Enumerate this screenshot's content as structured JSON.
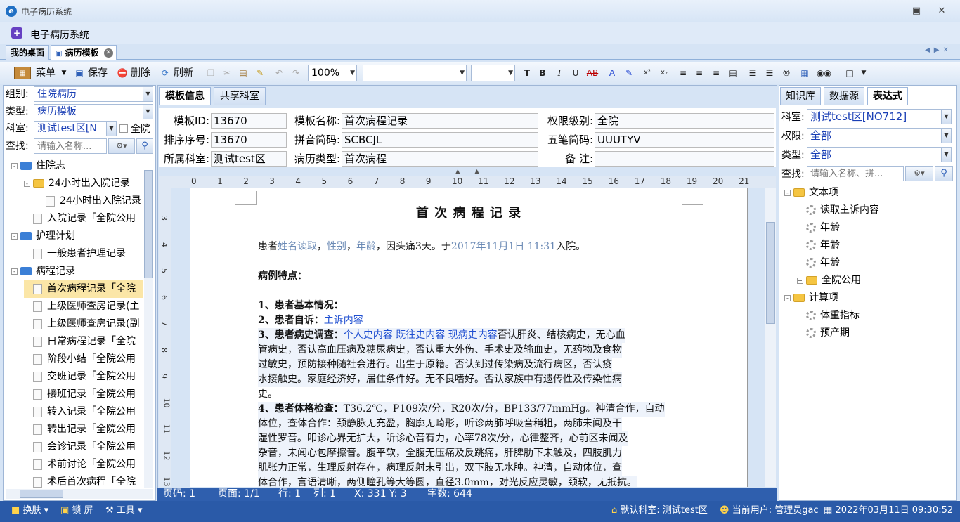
{
  "window": {
    "title": "电子病历系统",
    "subtitle": "电子病历系统"
  },
  "doc_tabs": [
    {
      "label": "我的桌面"
    },
    {
      "label": "病历模板"
    }
  ],
  "toolbar": {
    "menu": "菜单",
    "save": "保存",
    "delete": "删除",
    "refresh": "刷新",
    "zoom": "100%"
  },
  "left": {
    "group_label": "组别:",
    "group_value": "住院病历",
    "type_label": "类型:",
    "type_value": "病历模板",
    "dept_label": "科室:",
    "dept_value": "测试test区[N",
    "all_label": "全院",
    "search_label": "查找:",
    "search_placeholder": "请输入名称...",
    "tree": [
      {
        "text": "住院志",
        "indent": 0,
        "icon": "folder-blue",
        "pm": "-"
      },
      {
        "text": "24小时出入院记录",
        "indent": 1,
        "icon": "folder-yellow",
        "pm": "-"
      },
      {
        "text": "24小时出入院记录",
        "indent": 2,
        "icon": "page"
      },
      {
        "text": "入院记录「全院公用",
        "indent": 1,
        "icon": "page"
      },
      {
        "text": "护理计划",
        "indent": 0,
        "icon": "folder-blue",
        "pm": "-"
      },
      {
        "text": "一般患者护理记录",
        "indent": 1,
        "icon": "page"
      },
      {
        "text": "病程记录",
        "indent": 0,
        "icon": "folder-blue",
        "pm": "-"
      },
      {
        "text": "首次病程记录「全院",
        "indent": 1,
        "icon": "page",
        "selected": true
      },
      {
        "text": "上级医师查房记录(主",
        "indent": 1,
        "icon": "page"
      },
      {
        "text": "上级医师查房记录(副",
        "indent": 1,
        "icon": "page"
      },
      {
        "text": "日常病程记录「全院",
        "indent": 1,
        "icon": "page"
      },
      {
        "text": "阶段小结「全院公用",
        "indent": 1,
        "icon": "page"
      },
      {
        "text": "交班记录「全院公用",
        "indent": 1,
        "icon": "page"
      },
      {
        "text": "接班记录「全院公用",
        "indent": 1,
        "icon": "page"
      },
      {
        "text": "转入记录「全院公用",
        "indent": 1,
        "icon": "page"
      },
      {
        "text": "转出记录「全院公用",
        "indent": 1,
        "icon": "page"
      },
      {
        "text": "会诊记录「全院公用",
        "indent": 1,
        "icon": "page"
      },
      {
        "text": "术前讨论「全院公用",
        "indent": 1,
        "icon": "page"
      },
      {
        "text": "术后首次病程「全院",
        "indent": 1,
        "icon": "page"
      }
    ]
  },
  "center": {
    "tabs": [
      {
        "label": "模板信息"
      },
      {
        "label": "共享科室"
      }
    ],
    "fields": {
      "id_label": "模板ID:",
      "id": "13670",
      "name_label": "模板名称:",
      "name": "首次病程记录",
      "perm_label": "权限级别:",
      "perm": "全院",
      "order_label": "排序序号:",
      "order": "13670",
      "pinyin_label": "拼音简码:",
      "pinyin": "SCBCJL",
      "wubi_label": "五笔简码:",
      "wubi": "UUUTYV",
      "dept_label": "所属科室:",
      "dept": "测试test区",
      "rtype_label": "病历类型:",
      "rtype": "首次病程",
      "note_label": "备 注:",
      "note": ""
    },
    "ruler": [
      "0",
      "1",
      "2",
      "3",
      "4",
      "5",
      "6",
      "7",
      "8",
      "9",
      "10",
      "11",
      "12",
      "13",
      "14",
      "15",
      "16",
      "17",
      "18",
      "19",
      "20",
      "21"
    ],
    "vruler": [
      "3",
      "4",
      "5",
      "6",
      "7",
      "8",
      "9",
      "10",
      "11",
      "12",
      "13"
    ],
    "doc": {
      "title": "首 次 病 程 记 录",
      "l1a": "患者",
      "l1_name": "姓名读取",
      "l1_sex": "性别",
      "l1_age": "年龄",
      "l1b": "，因头痛3天。于",
      "l1_date": "2017年11月1日 11:31",
      "l1c": "入院。",
      "case_head": "病例特点：",
      "s1": "1、患者基本情况：",
      "s2": "2、患者自诉：",
      "s2v": "主诉内容",
      "s3": "3、患者病史调查：",
      "s3v": "个人史内容 既往史内容 现病史内容",
      "s3a": "否认肝炎、结核病史，无心血",
      "s3b": "管病史，否认高血压病及糖尿病史，否认重大外伤、手术史及输血史，无药物及食物",
      "s3c": "过敏史，预防接种随社会进行。出生于原籍。否认到过传染病及流行病区，否认疫",
      "s3d": "水接触史。家庭经济好，居住条件好。无不良嗜好。否认家族中有遗传性及传染性病",
      "s3e": "史。",
      "s4": "4、患者体格检查：",
      "s4a": "T36.2℃，P109次/分，R20次/分，BP133/77mmHg。神清合作，自动",
      "s4b": "体位，查体合作：颈静脉无充盈，胸廓无畸形，听诊两肺呼吸音稍粗，两肺未闻及干",
      "s4c": "湿性罗音。叩诊心界无扩大，听诊心音有力，心率78次/分，心律整齐，心前区未闻及",
      "s4d": "杂音，未闻心包摩擦音。腹平软，全腹无压痛及反跳痛，肝脾肋下未触及，四肢肌力",
      "s4e": "肌张力正常，生理反射存在，病理反射未引出，双下肢无水肿。神清，自动体位，查",
      "s4f": "体合作，言语清晰，两侧瞳孔等大等圆，直径3.0mm，对光反应灵敏，颈软，无抵抗。"
    },
    "status": {
      "page": "页码: 1",
      "pages": "页面: 1/1",
      "row": "行: 1",
      "col": "列: 1",
      "xy": "X: 331 Y: 3",
      "chars": "字数: 644"
    }
  },
  "right": {
    "tabs": [
      {
        "label": "知识库"
      },
      {
        "label": "数据源"
      },
      {
        "label": "表达式"
      }
    ],
    "dept_label": "科室:",
    "dept_value": "测试test区[NO712]",
    "perm_label": "权限:",
    "perm_value": "全部",
    "type_label": "类型:",
    "type_value": "全部",
    "search_label": "查找:",
    "search_placeholder": "请输入名称、拼...",
    "tree": [
      {
        "text": "文本项",
        "indent": 0,
        "icon": "folder-yellow",
        "pm": "-"
      },
      {
        "text": "读取主诉内容",
        "indent": 1,
        "icon": "gear"
      },
      {
        "text": "年龄",
        "indent": 1,
        "icon": "gear"
      },
      {
        "text": "年龄",
        "indent": 1,
        "icon": "gear"
      },
      {
        "text": "年龄",
        "indent": 1,
        "icon": "gear"
      },
      {
        "text": "全院公用",
        "indent": 1,
        "icon": "folder-yellow",
        "pm": "+"
      },
      {
        "text": "计算项",
        "indent": 0,
        "icon": "folder-yellow",
        "pm": "-"
      },
      {
        "text": "体重指标",
        "indent": 1,
        "icon": "gear"
      },
      {
        "text": "预产期",
        "indent": 1,
        "icon": "gear"
      }
    ]
  },
  "statusbar": {
    "skin": "换肤",
    "lock": "锁 屏",
    "tools": "工具",
    "dept": "默认科室: 测试test区",
    "user": "当前用户: 管理员gac",
    "time": "2022年03月11日 09:30:52"
  }
}
